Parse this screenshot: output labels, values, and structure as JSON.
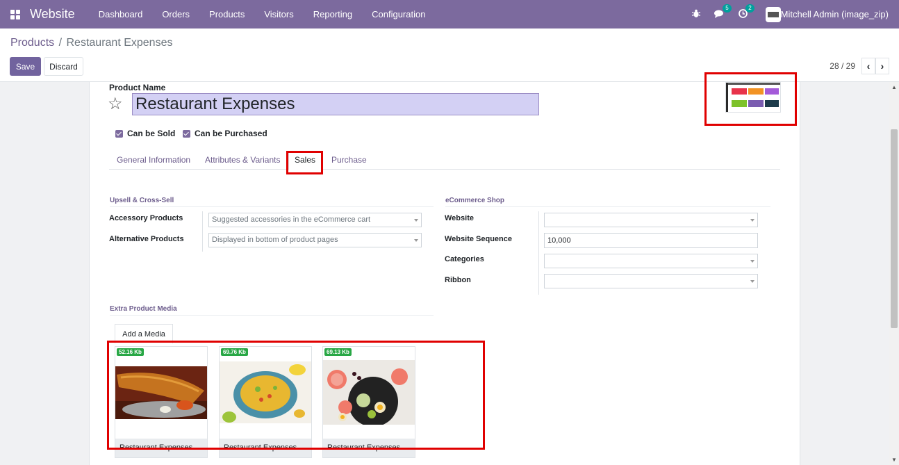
{
  "navbar": {
    "app_name": "Website",
    "menu": [
      "Dashboard",
      "Orders",
      "Products",
      "Visitors",
      "Reporting",
      "Configuration"
    ],
    "messages_count": "5",
    "activities_count": "2",
    "user": "Mitchell Admin (image_zip)"
  },
  "breadcrumb": {
    "parent": "Products",
    "separator": "/",
    "current": "Restaurant Expenses"
  },
  "buttons": {
    "save": "Save",
    "discard": "Discard"
  },
  "pager": {
    "value": "28 / 29",
    "prev": "‹",
    "next": "›"
  },
  "form": {
    "product_name_label": "Product Name",
    "product_name": "Restaurant Expenses",
    "can_be_sold": "Can be Sold",
    "can_be_purchased": "Can be Purchased",
    "tabs": [
      "General Information",
      "Attributes & Variants",
      "Sales",
      "Purchase"
    ],
    "active_tab": "Sales",
    "upsell": {
      "title": "Upsell & Cross-Sell",
      "accessory_label": "Accessory Products",
      "accessory_placeholder": "Suggested accessories in the eCommerce cart",
      "alternative_label": "Alternative Products",
      "alternative_placeholder": "Displayed in bottom of product pages"
    },
    "ecommerce": {
      "title": "eCommerce Shop",
      "website_label": "Website",
      "website_value": "",
      "sequence_label": "Website Sequence",
      "sequence_value": "10,000",
      "categories_label": "Categories",
      "categories_value": "",
      "ribbon_label": "Ribbon",
      "ribbon_value": ""
    },
    "media": {
      "title": "Extra Product Media",
      "add_button": "Add a Media",
      "items": [
        {
          "size": "52.16 Kb",
          "name": "Restaurant Expenses",
          "icon": "dosa-image"
        },
        {
          "size": "69.76 Kb",
          "name": "Restaurant Expenses",
          "icon": "rice-bowl-image"
        },
        {
          "size": "69.13 Kb",
          "name": "Restaurant Expenses",
          "icon": "salad-plate-image"
        }
      ]
    }
  },
  "colors": {
    "navbar": "#7c6a9e",
    "primary": "#71639e",
    "highlight": "#e00000",
    "badge": "#28a745"
  }
}
